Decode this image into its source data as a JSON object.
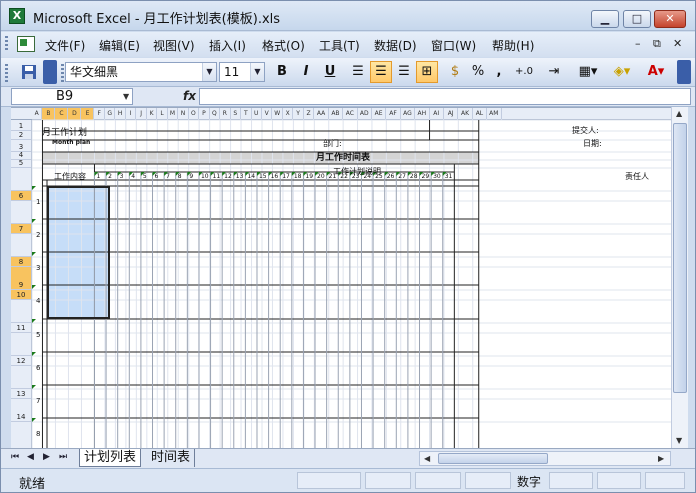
{
  "window": {
    "title": "Microsoft Excel - 月工作计划表(模板).xls",
    "app_icon": "excel-icon"
  },
  "menu": [
    "文件(F)",
    "编辑(E)",
    "视图(V)",
    "插入(I)",
    "格式(O)",
    "工具(T)",
    "数据(D)",
    "窗口(W)",
    "帮助(H)"
  ],
  "toolbar": {
    "font": "华文细黑",
    "size": "11",
    "bold": "B",
    "italic": "I",
    "underline": "U",
    "percent": "%",
    "comma": ",",
    "increase_decimal": "+.0",
    "active_tool": "align-center"
  },
  "formula": {
    "namebox": "B9",
    "fx": "fx",
    "value": ""
  },
  "columns": [
    "A",
    "B",
    "C",
    "D",
    "E",
    "F",
    "G",
    "H",
    "I",
    "J",
    "K",
    "L",
    "M",
    "N",
    "O",
    "P",
    "Q",
    "R",
    "S",
    "T",
    "U",
    "V",
    "W",
    "X",
    "Y",
    "Z",
    "AA",
    "AB",
    "AC",
    "AD",
    "AE",
    "AF",
    "AG",
    "AH",
    "AI",
    "AJ",
    "AK",
    "AL",
    "AM"
  ],
  "highlight_columns": [
    "B",
    "C",
    "D",
    "E"
  ],
  "rows": [
    "1",
    "2",
    "3",
    "4",
    "5",
    "",
    "6",
    "",
    "7",
    "",
    "8",
    "9",
    "10",
    "",
    "11",
    "",
    "12",
    "",
    "13",
    "14"
  ],
  "highlight_rows": [
    "6",
    "7",
    "8",
    "9",
    "10"
  ],
  "sheet": {
    "title_cn": "月工作计划",
    "title_en": "Month plan",
    "submitter": "提交人:",
    "department": "部门:",
    "date": "日期:",
    "table_title": "月工作时间表",
    "work_content": "工作内容",
    "plan_desc": "工作计划说明",
    "owner": "责任人",
    "days": [
      "1",
      "2",
      "3",
      "4",
      "5",
      "6",
      "7",
      "8",
      "9",
      "10",
      "11",
      "12",
      "13",
      "14",
      "15",
      "16",
      "17",
      "18",
      "19",
      "20",
      "21",
      "22",
      "23",
      "24",
      "25",
      "26",
      "27",
      "28",
      "29",
      "30",
      "31"
    ],
    "items": [
      "1",
      "2",
      "3",
      "4",
      "5",
      "6",
      "7",
      "8"
    ]
  },
  "tabs": [
    "计划列表",
    "时间表"
  ],
  "status": {
    "ready": "就绪",
    "num": "数字"
  },
  "colors": {
    "selection": "#c6ddf8",
    "header_highlight": "#f8c35f",
    "title_bar": "#d4d4d4",
    "day_marker": "#1a7a1a"
  }
}
